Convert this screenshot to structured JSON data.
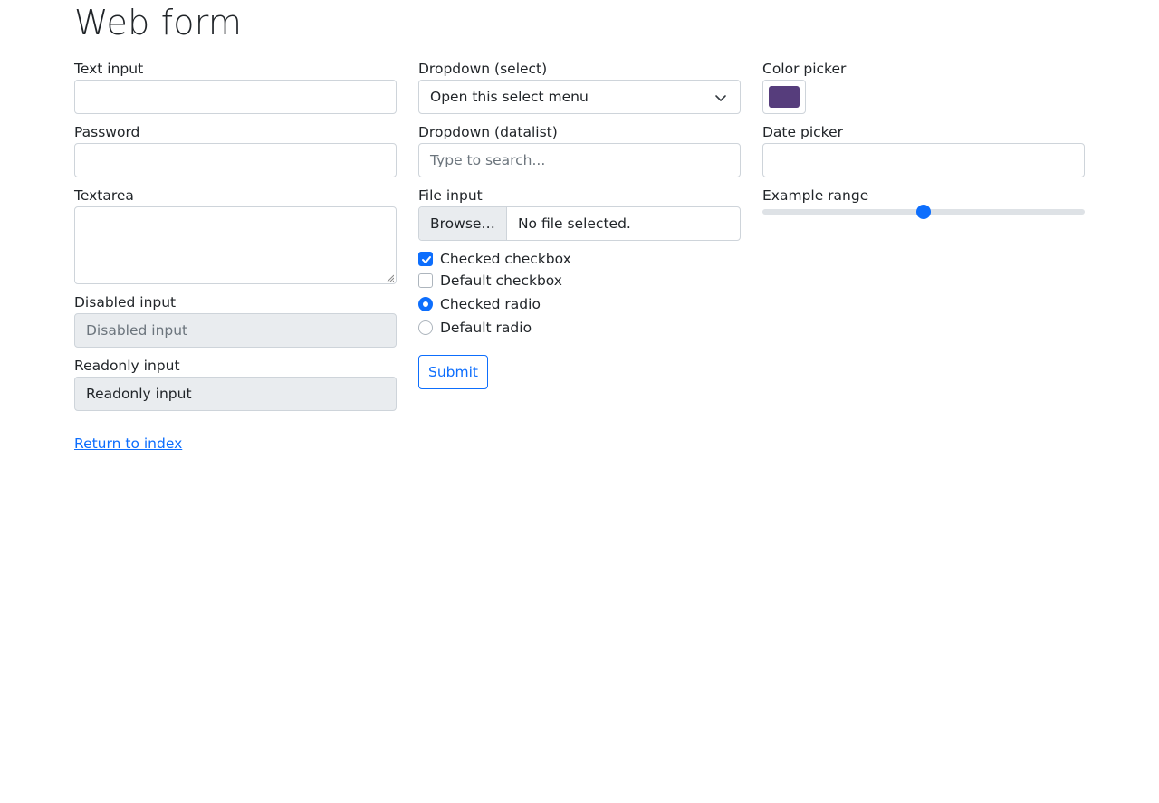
{
  "page": {
    "title": "Web form"
  },
  "col1": {
    "text_input": {
      "label": "Text input",
      "value": ""
    },
    "password": {
      "label": "Password",
      "value": ""
    },
    "textarea": {
      "label": "Textarea",
      "value": ""
    },
    "disabled": {
      "label": "Disabled input",
      "placeholder": "Disabled input"
    },
    "readonly": {
      "label": "Readonly input",
      "value": "Readonly input"
    }
  },
  "col2": {
    "select": {
      "label": "Dropdown (select)",
      "selected": "Open this select menu"
    },
    "datalist": {
      "label": "Dropdown (datalist)",
      "placeholder": "Type to search..."
    },
    "file": {
      "label": "File input",
      "button": "Browse…",
      "status": "No file selected."
    },
    "checkboxes": [
      {
        "label": "Checked checkbox",
        "checked": true
      },
      {
        "label": "Default checkbox",
        "checked": false
      }
    ],
    "radios": [
      {
        "label": "Checked radio",
        "checked": true
      },
      {
        "label": "Default radio",
        "checked": false
      }
    ],
    "submit_label": "Submit"
  },
  "col3": {
    "color": {
      "label": "Color picker",
      "value": "#563d7c"
    },
    "date": {
      "label": "Date picker",
      "value": ""
    },
    "range": {
      "label": "Example range",
      "value_fraction": 0.5
    }
  },
  "footer": {
    "return_link": "Return to index"
  },
  "colors": {
    "accent": "#0d6efd",
    "border": "#ced4da",
    "disabled_bg": "#e9ecef"
  }
}
